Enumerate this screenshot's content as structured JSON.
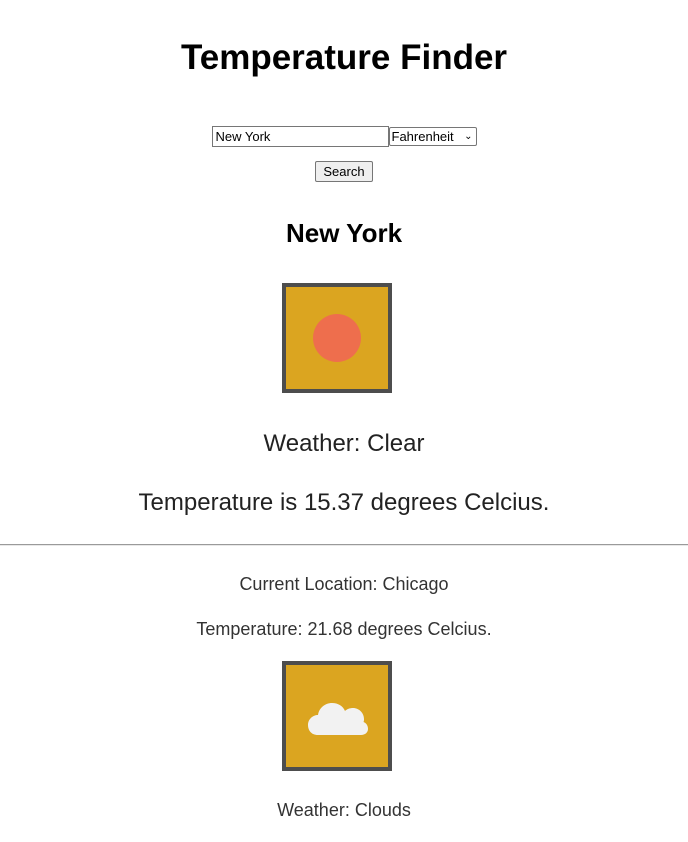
{
  "app": {
    "title": "Temperature Finder"
  },
  "search": {
    "city_value": "New York",
    "unit_selected": "Fahrenheit",
    "unit_options": [
      "Fahrenheit"
    ],
    "button_label": "Search"
  },
  "result": {
    "city": "New York",
    "weather_text": "Weather: Clear",
    "temperature_text": "Temperature is 15.37 degrees Celcius.",
    "icon": "sun-icon"
  },
  "current": {
    "location_text": "Current Location: Chicago",
    "temperature_text": "Temperature: 21.68 degrees Celcius.",
    "weather_text": "Weather: Clouds",
    "icon": "cloud-icon"
  },
  "colors": {
    "tile_background": "#dba520",
    "tile_border": "#4d4d4d",
    "sun": "#ee6e4d",
    "cloud": "#f2f2f2"
  }
}
